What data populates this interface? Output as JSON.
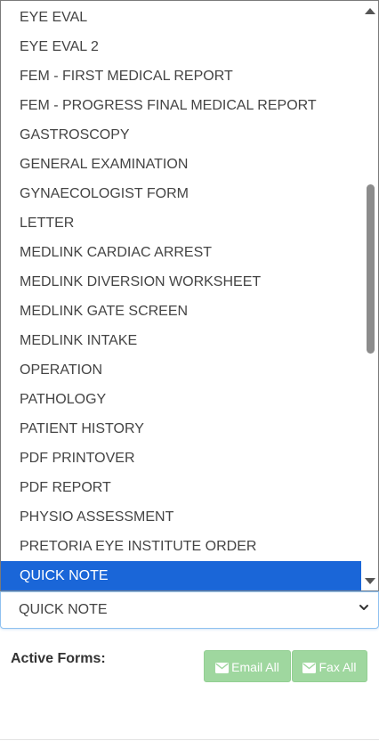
{
  "dropdown": {
    "options": [
      "EYE EVAL",
      "EYE EVAL 2",
      "FEM - FIRST MEDICAL REPORT",
      "FEM - PROGRESS FINAL MEDICAL REPORT",
      "GASTROSCOPY",
      "GENERAL EXAMINATION",
      "GYNAECOLOGIST FORM",
      "LETTER",
      "MEDLINK CARDIAC ARREST",
      "MEDLINK DIVERSION WORKSHEET",
      "MEDLINK GATE SCREEN",
      "MEDLINK INTAKE",
      "OPERATION",
      "PATHOLOGY",
      "PATIENT HISTORY",
      "PDF PRINTOVER",
      "PDF REPORT",
      "PHYSIO ASSESSMENT",
      "PRETORIA EYE INSTITUTE ORDER",
      "QUICK NOTE"
    ],
    "highlighted_option": "QUICK NOTE",
    "highlight_color": "#1a66d8"
  },
  "select": {
    "value": "QUICK NOTE",
    "icon": "chevron-down-icon"
  },
  "active_forms": {
    "label": "Active Forms:",
    "email_all_label": "Email All",
    "email_icon": "envelope-icon",
    "fax_all_label": "Fax All",
    "fax_icon": "envelope-icon",
    "button_color": "#9fd79f"
  }
}
